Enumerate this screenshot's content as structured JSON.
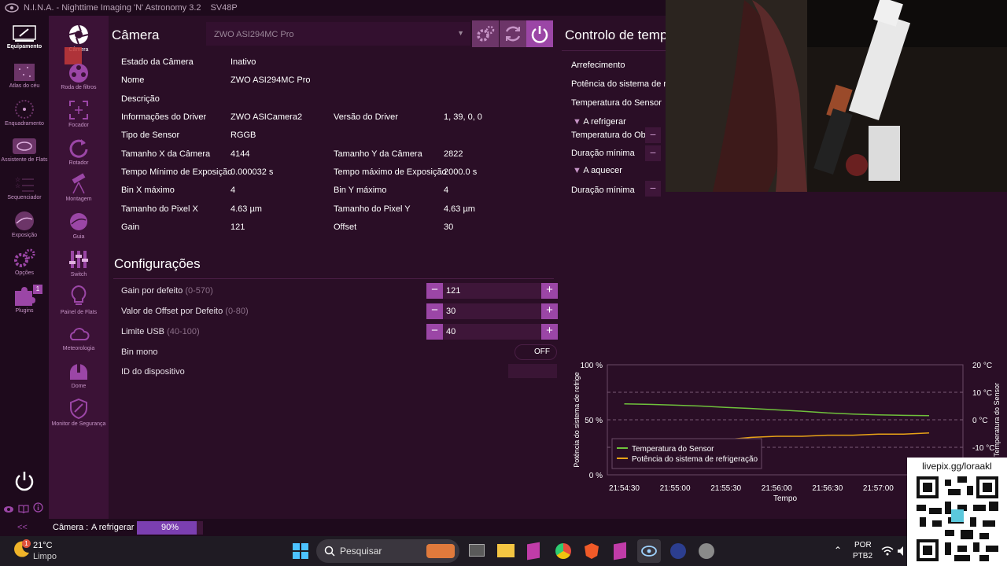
{
  "window": {
    "title": "N.I.N.A. - Nighttime Imaging 'N' Astronomy 3.2",
    "profile": "SV48P"
  },
  "rail1": {
    "items": [
      {
        "label": "Equipamento",
        "icon": "equipment-icon"
      },
      {
        "label": "Atlas do céu",
        "icon": "sky-atlas-icon"
      },
      {
        "label": "Enquadramento",
        "icon": "framing-icon"
      },
      {
        "label": "Assistente de Flats",
        "icon": "flat-wizard-icon"
      },
      {
        "label": "Sequenciador",
        "icon": "sequencer-icon"
      },
      {
        "label": "Exposição",
        "icon": "imaging-icon"
      },
      {
        "label": "Opções",
        "icon": "gear-icon"
      },
      {
        "label": "Plugins",
        "icon": "puzzle-icon",
        "badge": "1"
      }
    ]
  },
  "rail2": {
    "items": [
      {
        "label": "Câmera",
        "icon": "camera-icon"
      },
      {
        "label": "Roda de filtros",
        "icon": "filter-wheel-icon"
      },
      {
        "label": "Focador",
        "icon": "focuser-icon"
      },
      {
        "label": "Rotador",
        "icon": "rotator-icon"
      },
      {
        "label": "Montagem",
        "icon": "telescope-icon"
      },
      {
        "label": "Guia",
        "icon": "guider-icon"
      },
      {
        "label": "Switch",
        "icon": "switch-icon"
      },
      {
        "label": "Painel de Flats",
        "icon": "flat-panel-icon"
      },
      {
        "label": "Meteorologia",
        "icon": "weather-icon"
      },
      {
        "label": "Dome",
        "icon": "dome-icon"
      },
      {
        "label": "Monitor de Segurança",
        "icon": "shield-icon"
      }
    ]
  },
  "camera": {
    "title": "Câmera",
    "device": "ZWO ASI294MC Pro",
    "info": [
      {
        "label": "Estado da Câmera",
        "value": "Inativo"
      },
      {
        "label": "Nome",
        "value": "ZWO ASI294MC Pro"
      },
      {
        "label": "Descrição",
        "value": ""
      },
      {
        "label": "Informações do Driver",
        "value": "ZWO ASICamera2",
        "label2": "Versão do Driver",
        "value2": "1, 39, 0, 0"
      },
      {
        "label": "Tipo de Sensor",
        "value": "RGGB"
      },
      {
        "label": "Tamanho X da Câmera",
        "value": "4144",
        "label2": "Tamanho Y da Câmera",
        "value2": "2822"
      },
      {
        "label": "Tempo Mínimo de Exposição",
        "value": "0.000032 s",
        "label2": "Tempo máximo de Exposição",
        "value2": "2000.0 s"
      },
      {
        "label": "Bin X máximo",
        "value": "4",
        "label2": "Bin Y máximo",
        "value2": "4"
      },
      {
        "label": "Tamanho do Pixel X",
        "value": "4.63 µm",
        "label2": "Tamanho do Pixel Y",
        "value2": "4.63 µm"
      },
      {
        "label": "Gain",
        "value": "121",
        "label2": "Offset",
        "value2": "30"
      }
    ]
  },
  "settings": {
    "title": "Configurações",
    "gain": {
      "label": "Gain por defeito",
      "range": "(0-570)",
      "value": "121"
    },
    "offset": {
      "label": "Valor de Offset por Defeito",
      "range": "(0-80)",
      "value": "30"
    },
    "usb": {
      "label": "Limite USB",
      "range": "(40-100)",
      "value": "40"
    },
    "binmono": {
      "label": "Bin mono",
      "value": "OFF"
    },
    "deviceid": {
      "label": "ID do dispositivo"
    }
  },
  "cooling": {
    "title": "Controlo de temp",
    "rows": [
      {
        "label": "Arrefecimento"
      },
      {
        "label": "Potência do sistema de refri"
      },
      {
        "label": "Temperatura do Sensor"
      }
    ],
    "cool_header": "A refrigerar",
    "cool_target": "Temperatura do Obje",
    "cool_min": "Duração mínima",
    "warm_header": "A aquecer",
    "warm_min": "Duração mínima"
  },
  "chart_data": {
    "type": "line",
    "title": "",
    "xlabel": "Tempo",
    "ylabel": "Potência do sistema de refrige",
    "y2label": "Temperatura do Sensor",
    "y_ticks": [
      "100 %",
      "50 %",
      "0 %"
    ],
    "y2_ticks": [
      "20 °C",
      "10 °C",
      "0 °C",
      "-10 °C"
    ],
    "x_ticks": [
      "21:54:30",
      "21:55:00",
      "21:55:30",
      "21:56:00",
      "21:56:30",
      "21:57:00"
    ],
    "ylim": [
      0,
      100
    ],
    "y2lim": [
      -20,
      20
    ],
    "x": [
      "21:54:30",
      "21:54:45",
      "21:55:00",
      "21:55:15",
      "21:55:30",
      "21:55:45",
      "21:56:00",
      "21:56:15",
      "21:56:30",
      "21:56:45",
      "21:57:00",
      "21:57:15",
      "21:57:30"
    ],
    "series": [
      {
        "name": "Temperatura do Sensor",
        "axis": "right",
        "color": "#6fc13c",
        "values": [
          5.8,
          5.6,
          5.3,
          5.0,
          4.5,
          4.1,
          3.6,
          3.1,
          2.5,
          2.1,
          1.8,
          1.6,
          1.5
        ]
      },
      {
        "name": "Potência do sistema de refrigeração",
        "axis": "left",
        "color": "#e8a317",
        "values": [
          31,
          31,
          31,
          32,
          32,
          34,
          35,
          35,
          36,
          36,
          37,
          37,
          38
        ]
      }
    ],
    "legend": "bottom-left"
  },
  "statusbar": {
    "collapse": "<<",
    "device": "Câmera :",
    "state": "A refrigerar",
    "progress_text": "90%",
    "progress": 0.9
  },
  "taskbar": {
    "temp": "21°C",
    "weather": "Limpo",
    "weather_badge": "1",
    "search": "Pesquisar",
    "lang1": "POR",
    "lang2": "PTB2"
  },
  "overlay": {
    "qr_text": "livepix.gg/loraakl"
  }
}
